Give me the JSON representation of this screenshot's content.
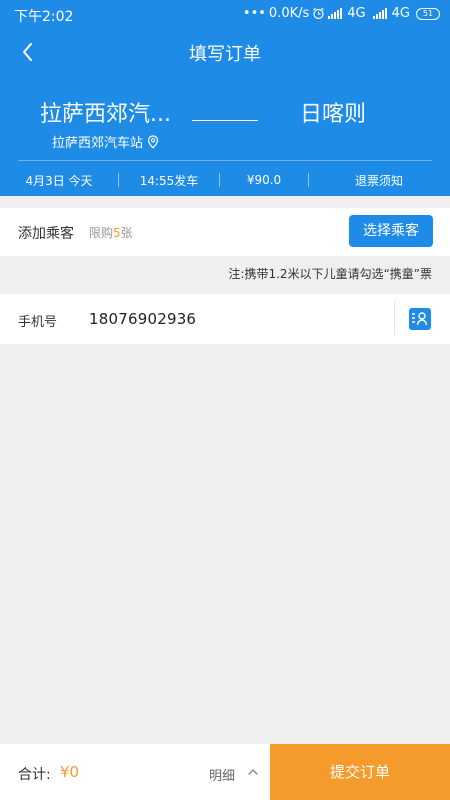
{
  "status_bar": {
    "time": "下午2:02",
    "network_speed": "0.0K/s",
    "signal_1_label": "4G",
    "signal_2_label": "4G",
    "battery": "51"
  },
  "navbar": {
    "title": "填写订单"
  },
  "route": {
    "from": "拉萨西郊汽...",
    "to": "日喀则",
    "station": "拉萨西郊汽车站"
  },
  "trip_info": {
    "date": "4月3日 今天",
    "departure": "14:55发车",
    "price": "¥90.0",
    "refund_notice": "退票须知"
  },
  "passenger": {
    "label": "添加乘客",
    "limit_prefix": "限购",
    "limit_count": "5",
    "limit_suffix": "张",
    "select_button": "选择乘客"
  },
  "note": "注:携带1.2米以下儿童请勾选“携童”票",
  "phone": {
    "label": "手机号",
    "value": "18076902936"
  },
  "footer": {
    "total_label": "合计:",
    "total_value": "¥0",
    "detail_label": "明细",
    "submit_button": "提交订单"
  },
  "colors": {
    "primary": "#1e8ce6",
    "accent": "#f49b2c",
    "background": "#efefef"
  },
  "icons": {
    "back": "back-arrow-icon",
    "location": "location-pin-icon",
    "contacts": "contacts-book-icon",
    "chevron": "chevron-up-icon"
  }
}
